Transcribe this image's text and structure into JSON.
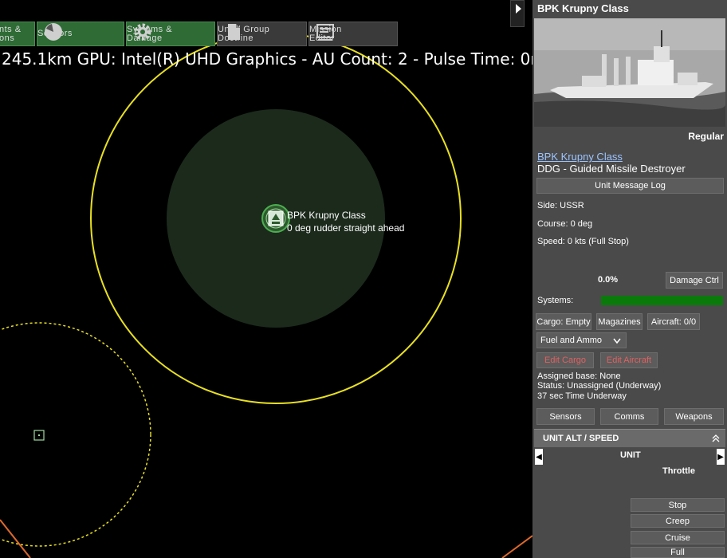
{
  "toolbar": {
    "items": [
      {
        "label": "nts &\nons",
        "icon": "weapons-icon"
      },
      {
        "label": "Sensors",
        "icon": "radar-icon"
      },
      {
        "label": "Systems &\nDamage",
        "icon": "gear-icon"
      },
      {
        "label": "Unit / Group\nDoctrine",
        "icon": "document-icon"
      },
      {
        "label": "Mission\nEditor",
        "icon": "mission-editor-icon"
      }
    ]
  },
  "map": {
    "status_line": "245.1km GPU: Intel(R) UHD Graphics - AU Count: 2 - Pulse Time: 0n",
    "unit_name": "BPK Krupny Class",
    "unit_course": "0 deg  rudder straight ahead",
    "colors": {
      "range_ring": "#e8e020",
      "detection": "#1c2a1c",
      "contact_ring": "#e8e020",
      "edge": "#e06a2a"
    }
  },
  "panel": {
    "title": "BPK Krupny Class",
    "proficiency": "Regular",
    "class_link": "BPK Krupny Class",
    "type": "DDG - Guided Missile Destroyer",
    "message_log_button": "Unit Message Log",
    "side": "Side: USSR",
    "course": "Course: 0 deg",
    "speed": "Speed: 0 kts (Full Stop)",
    "damage_percent": "0.0%",
    "damage_ctrl_button": "Damage Ctrl",
    "systems_label": "Systems:",
    "systems_health": 1.0,
    "cargo_button": "Cargo: Empty",
    "magazines_button": "Magazines",
    "aircraft_button": "Aircraft: 0/0",
    "dropdown_value": "Fuel and Ammo",
    "edit_cargo_button": "Edit Cargo",
    "edit_aircraft_button": "Edit Aircraft",
    "assigned_base": "Assigned base: None",
    "status": "Status: Unassigned (Underway)",
    "time_underway": "37 sec Time Underway",
    "sensors_button": "Sensors",
    "comms_button": "Comms",
    "weapons_button": "Weapons",
    "alt_speed_header": "UNIT ALT / SPEED",
    "unit_label": "UNIT",
    "throttle_label": "Throttle",
    "speed_buttons": [
      "Stop",
      "Creep",
      "Cruise",
      "Full"
    ]
  }
}
